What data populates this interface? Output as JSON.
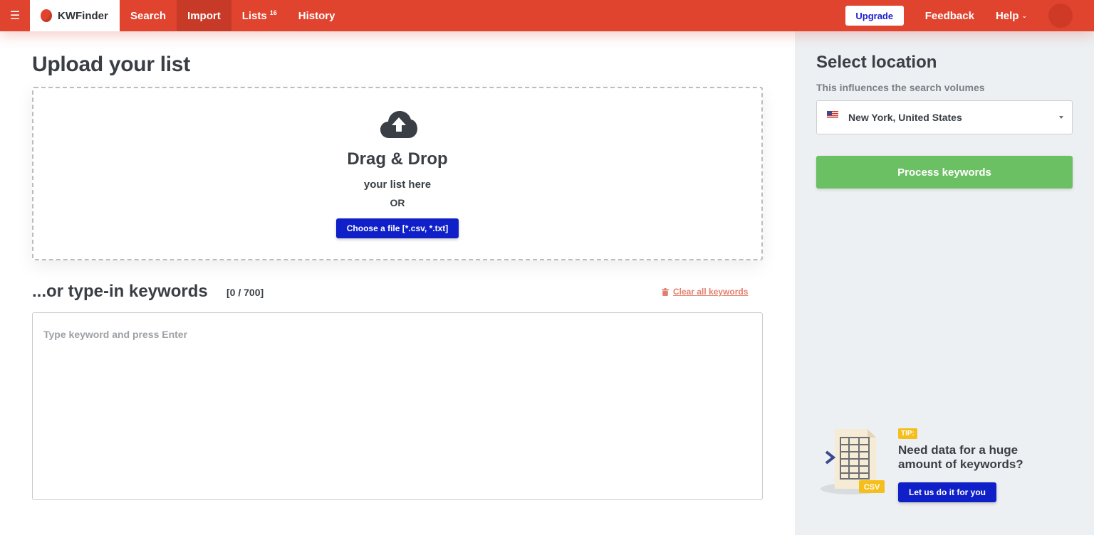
{
  "app": {
    "name": "KWFinder"
  },
  "nav": {
    "items": [
      {
        "label": "Search"
      },
      {
        "label": "Import",
        "active": true
      },
      {
        "label": "Lists",
        "badge": "16"
      },
      {
        "label": "History"
      }
    ],
    "upgrade_label": "Upgrade",
    "feedback_label": "Feedback",
    "help_label": "Help"
  },
  "upload": {
    "title": "Upload your list",
    "drag_title": "Drag & Drop",
    "drag_sub": "your list here",
    "or": "OR",
    "choose_label": "Choose a file [*.csv, *.txt]"
  },
  "keywords": {
    "title": "...or type-in keywords",
    "counter": "[0 / 700]",
    "clear_label": "Clear all keywords",
    "placeholder": "Type keyword and press Enter",
    "value": ""
  },
  "sidebar": {
    "title": "Select location",
    "subtitle": "This influences the search volumes",
    "location": "New York, United States",
    "process_label": "Process keywords",
    "tip_badge": "TIP:",
    "tip_text": "Need data for a huge amount of keywords?",
    "tip_button": "Let us do it for you",
    "tip_csv_label": "CSV"
  },
  "colors": {
    "brand_red": "#e0432e",
    "primary_blue": "#1020c8",
    "process_green": "#6cc064",
    "tip_yellow": "#f6be1c",
    "sidebar_bg": "#edf0f3"
  }
}
